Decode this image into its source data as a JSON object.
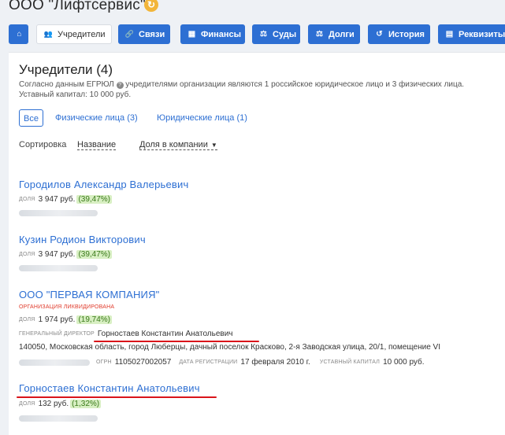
{
  "company": {
    "title": "ООО \"Лифтсервис\""
  },
  "nav": [
    {
      "label": "",
      "icon": "home-icon",
      "glyph": "⌂"
    },
    {
      "label": "Учредители",
      "icon": "users-icon",
      "glyph": "👥",
      "active": true
    },
    {
      "label": "Связи",
      "icon": "link-icon",
      "glyph": "🔗"
    },
    {
      "label": "Финансы",
      "icon": "chart-icon",
      "glyph": "▦"
    },
    {
      "label": "Суды",
      "icon": "gavel-icon",
      "glyph": "⚖"
    },
    {
      "label": "Долги",
      "icon": "scales-icon",
      "glyph": "⚖"
    },
    {
      "label": "История",
      "icon": "history-icon",
      "glyph": "↺"
    },
    {
      "label": "Реквизиты",
      "icon": "document-icon",
      "glyph": "▤"
    }
  ],
  "section": {
    "title": "Учредители (4)",
    "desc_before": "Согласно данным ЕГРЮЛ",
    "desc_after": "учредителями организации являются 1 российское юридическое лицо и 3 физических лица.",
    "capital": "Уставный капитал: 10 000 руб."
  },
  "filters": {
    "all": "Все",
    "individuals": "Физические лица (3)",
    "legal": "Юридические лица (1)"
  },
  "sort": {
    "label": "Сортировка",
    "by_name": "Название",
    "by_share": "Доля в компании"
  },
  "labels": {
    "share": "доля",
    "director": "генеральный директор",
    "ogrn": "огрн",
    "reg_date": "дата регистрации",
    "capital": "уставный капитал"
  },
  "founders": [
    {
      "name": "Городилов Александр Валерьевич",
      "amount": "3 947 руб.",
      "pct": "(39,47%)"
    },
    {
      "name": "Кузин Родион Викторович",
      "amount": "3 947 руб.",
      "pct": "(39,47%)"
    },
    {
      "name": "ООО \"ПЕРВАЯ КОМПАНИЯ\"",
      "status": "организация ликвидирована",
      "amount": "1 974 руб.",
      "pct": "(19,74%)",
      "director": "Горностаев Константин Анатольевич",
      "address": "140050, Московская область, город Люберцы, дачный поселок Красково, 2-я Заводская улица, 20/1, помещение VI",
      "ogrn": "1105027002057",
      "reg_date": "17 февраля 2010 г.",
      "capital": "10 000 руб."
    },
    {
      "name": "Горностаев Константин Анатольевич",
      "amount": "132 руб.",
      "pct": "(1,32%)"
    }
  ],
  "colors": {
    "accent": "#2d6fd3",
    "highlight": "#d9141a",
    "share_bg": "#d8efc3",
    "liquidated": "#e03a2a"
  }
}
